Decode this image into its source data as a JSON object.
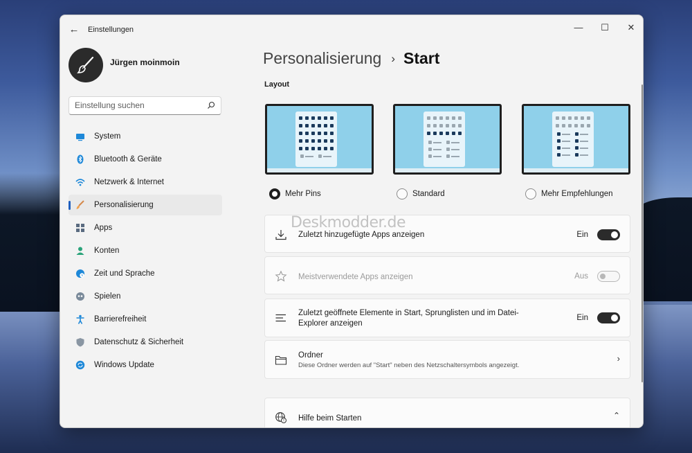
{
  "window": {
    "title": "Einstellungen"
  },
  "user": {
    "name": "Jürgen moinmoin"
  },
  "search": {
    "placeholder": "Einstellung suchen"
  },
  "sidebar": {
    "items": [
      {
        "label": "System",
        "icon": "monitor-icon",
        "active": false
      },
      {
        "label": "Bluetooth & Geräte",
        "icon": "bluetooth-icon",
        "active": false
      },
      {
        "label": "Netzwerk & Internet",
        "icon": "wifi-icon",
        "active": false
      },
      {
        "label": "Personalisierung",
        "icon": "brush-icon",
        "active": true
      },
      {
        "label": "Apps",
        "icon": "apps-icon",
        "active": false
      },
      {
        "label": "Konten",
        "icon": "person-icon",
        "active": false
      },
      {
        "label": "Zeit und Sprache",
        "icon": "globe-clock-icon",
        "active": false
      },
      {
        "label": "Spielen",
        "icon": "gamepad-icon",
        "active": false
      },
      {
        "label": "Barrierefreiheit",
        "icon": "accessibility-icon",
        "active": false
      },
      {
        "label": "Datenschutz & Sicherheit",
        "icon": "shield-icon",
        "active": false
      },
      {
        "label": "Windows Update",
        "icon": "update-icon",
        "active": false
      }
    ]
  },
  "breadcrumb": {
    "parent": "Personalisierung",
    "separator": "›",
    "current": "Start"
  },
  "layout": {
    "label": "Layout",
    "options": [
      {
        "label": "Mehr Pins",
        "selected": true
      },
      {
        "label": "Standard",
        "selected": false
      },
      {
        "label": "Mehr Empfehlungen",
        "selected": false
      }
    ]
  },
  "settings": {
    "recent_apps": {
      "title": "Zuletzt hinzugefügte Apps anzeigen",
      "state": "Ein",
      "on": true
    },
    "most_used": {
      "title": "Meistverwendete Apps anzeigen",
      "state": "Aus",
      "on": false
    },
    "recent_items": {
      "title_line1": "Zuletzt geöffnete Elemente in Start, Sprunglisten und im Datei-",
      "title_line2": "Explorer anzeigen",
      "state": "Ein",
      "on": true
    },
    "folders": {
      "title": "Ordner",
      "subtitle": "Diese Ordner werden auf \"Start\" neben des Netzschaltersymbols angezeigt."
    },
    "help": {
      "title": "Hilfe beim Starten"
    }
  },
  "watermark": {
    "text": "Deskmodder.de"
  },
  "colors": {
    "accent": "#1f5fbf",
    "toggle_on": "#2b2b2b",
    "layout_bg": "#8fd0ea"
  }
}
